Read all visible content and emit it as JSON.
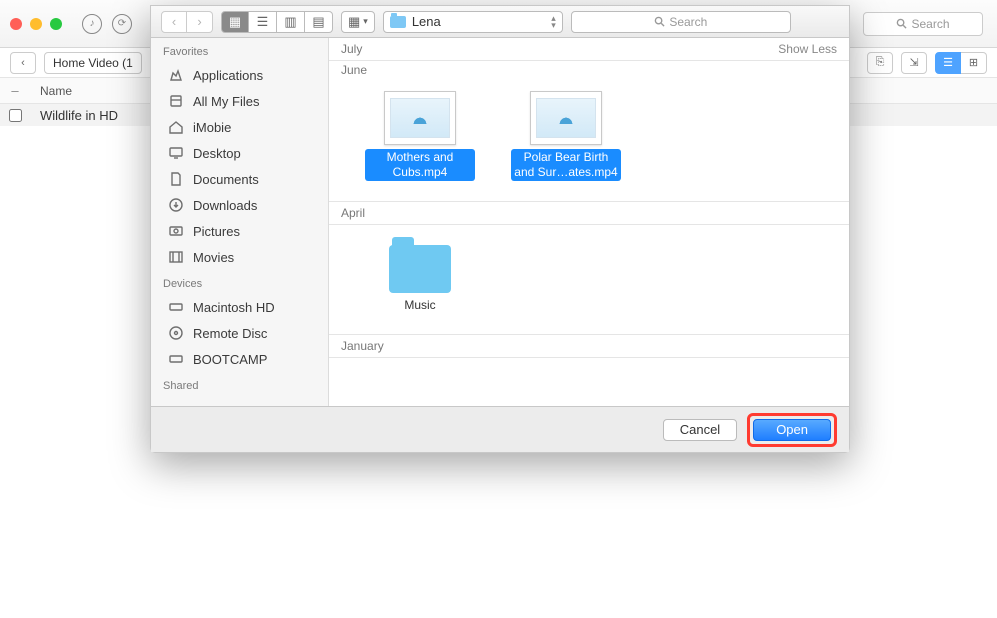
{
  "bg": {
    "search_placeholder": "Search",
    "back": "‹",
    "crumb": "Home Video (1",
    "name_col": "Name",
    "row1": "Wildlife in HD"
  },
  "dialog": {
    "path": "Lena",
    "search_placeholder": "Search",
    "sidebar": {
      "favorites_hdr": "Favorites",
      "favorites": [
        "Applications",
        "All My Files",
        "iMobie",
        "Desktop",
        "Documents",
        "Downloads",
        "Pictures",
        "Movies"
      ],
      "devices_hdr": "Devices",
      "devices": [
        "Macintosh HD",
        "Remote Disc",
        "BOOTCAMP"
      ],
      "shared_hdr": "Shared"
    },
    "sections": {
      "july": "July",
      "show_less": "Show Less",
      "june": "June",
      "april": "April",
      "january": "January"
    },
    "files": {
      "mothers": "Mothers and Cubs.mp4",
      "polar": "Polar Bear Birth and Sur…ates.mp4",
      "music": "Music"
    },
    "cancel": "Cancel",
    "open": "Open"
  }
}
